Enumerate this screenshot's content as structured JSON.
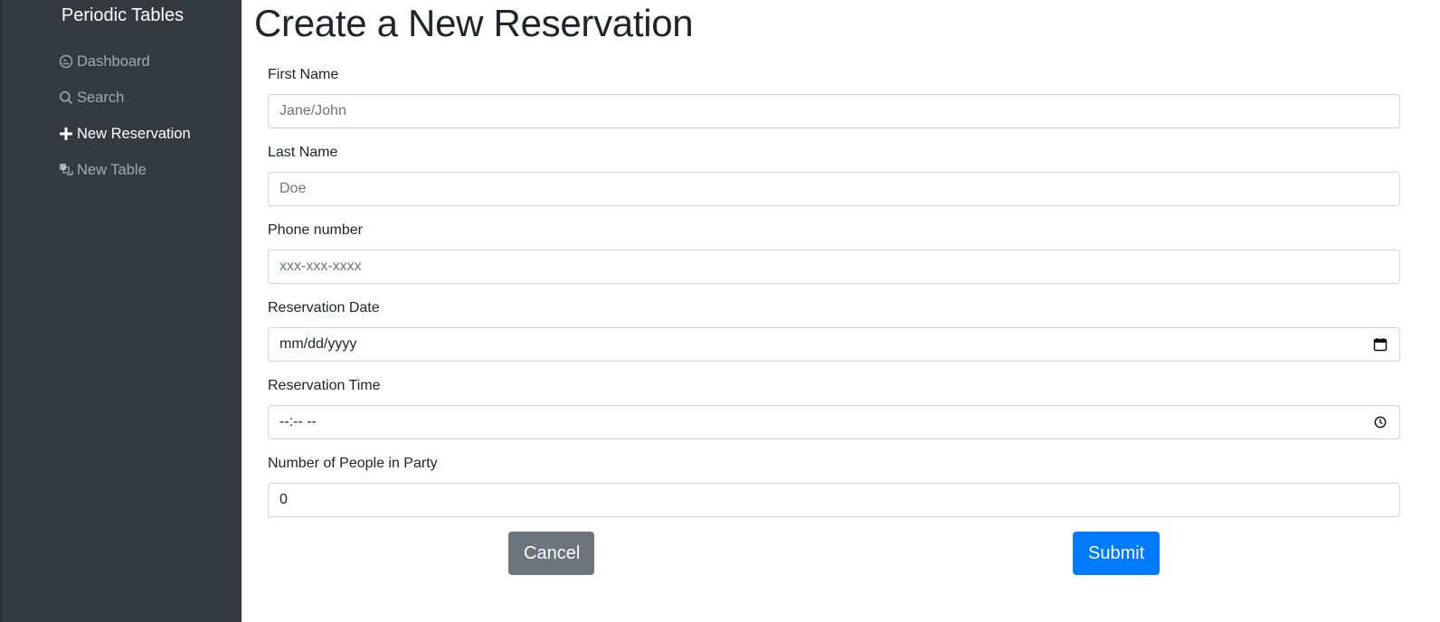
{
  "sidebar": {
    "brand": "Periodic Tables",
    "items": [
      {
        "label": "Dashboard",
        "icon": "dashboard-icon",
        "active": false
      },
      {
        "label": "Search",
        "icon": "search-icon",
        "active": false
      },
      {
        "label": "New Reservation",
        "icon": "plus-icon",
        "active": true
      },
      {
        "label": "New Table",
        "icon": "layers-icon",
        "active": false
      }
    ]
  },
  "main": {
    "title": "Create a New Reservation",
    "form": {
      "first_name": {
        "label": "First Name",
        "placeholder": "Jane/John"
      },
      "last_name": {
        "label": "Last Name",
        "placeholder": "Doe"
      },
      "phone": {
        "label": "Phone number",
        "placeholder": "xxx-xxx-xxxx"
      },
      "date": {
        "label": "Reservation Date",
        "placeholder": "mm/dd/yyyy",
        "icon": "calendar-icon"
      },
      "time": {
        "label": "Reservation Time",
        "placeholder": "--:-- --",
        "icon": "clock-icon"
      },
      "people": {
        "label": "Number of People in Party",
        "value": "0"
      }
    },
    "buttons": {
      "cancel": "Cancel",
      "submit": "Submit"
    }
  },
  "colors": {
    "sidebar_bg": "#343a40",
    "cancel_bg": "#6c757d",
    "submit_bg": "#007bff"
  }
}
